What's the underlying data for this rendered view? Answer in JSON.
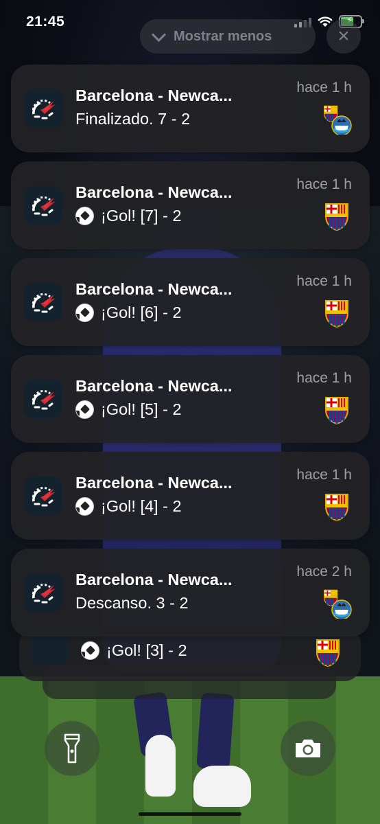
{
  "status_bar": {
    "time": "21:45"
  },
  "notification_center": {
    "show_less_label": "Mostrar menos",
    "clear_label": "×"
  },
  "notifications": [
    {
      "title": "Barcelona - Newca...",
      "time": "hace 1 h",
      "body": "Finalizado. 7 - 2",
      "has_ball": false,
      "crest": "barca-newcastle"
    },
    {
      "title": "Barcelona - Newca...",
      "time": "hace 1 h",
      "body": "¡Gol! [7] - 2",
      "has_ball": true,
      "crest": "barca"
    },
    {
      "title": "Barcelona - Newca...",
      "time": "hace 1 h",
      "body": "¡Gol! [6] - 2",
      "has_ball": true,
      "crest": "barca"
    },
    {
      "title": "Barcelona - Newca...",
      "time": "hace 1 h",
      "body": "¡Gol! [5] - 2",
      "has_ball": true,
      "crest": "barca"
    },
    {
      "title": "Barcelona - Newca...",
      "time": "hace 1 h",
      "body": "¡Gol! [4] - 2",
      "has_ball": true,
      "crest": "barca"
    },
    {
      "title": "Barcelona - Newca...",
      "time": "hace 2 h",
      "body": "Descanso. 3 - 2",
      "has_ball": false,
      "crest": "barca-newcastle"
    }
  ],
  "stacked_notification": {
    "body": "¡Gol! [3] - 2"
  },
  "lock_screen": {
    "flashlight_icon": "flashlight-icon",
    "camera_icon": "camera-icon"
  },
  "colors": {
    "app_icon_bg": "#14222e",
    "app_icon_accent": "#e8303a",
    "card_bg": "#222226"
  }
}
